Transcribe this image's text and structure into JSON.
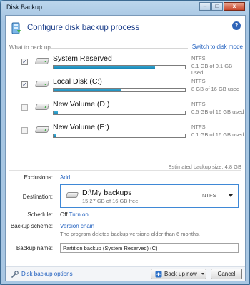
{
  "window": {
    "title": "Disk Backup",
    "controls": {
      "minimize": "–",
      "maximize": "□",
      "close": "x"
    }
  },
  "header": {
    "title": "Configure disk backup process",
    "help_icon": "?"
  },
  "what_to_back_up": {
    "label": "What to back up",
    "switch_link": "Switch to disk mode",
    "disks": [
      {
        "name": "System Reserved",
        "checked": true,
        "fs": "NTFS",
        "used": "0.1 GB of 0.1 GB used",
        "usage_fraction": 0.77
      },
      {
        "name": "Local Disk (C:)",
        "checked": true,
        "fs": "NTFS",
        "used": "8 GB of 16 GB used",
        "usage_fraction": 0.51
      },
      {
        "name": "New Volume (D:)",
        "checked": false,
        "fs": "NTFS",
        "used": "0.5 GB of 16 GB used",
        "usage_fraction": 0.03
      },
      {
        "name": "New Volume (E:)",
        "checked": false,
        "fs": "NTFS",
        "used": "0.1 GB of 16 GB used",
        "usage_fraction": 0.02
      }
    ],
    "checkmark": "✓"
  },
  "estimate": "Estimated backup size:  4.8 GB",
  "exclusions": {
    "label": "Exclusions:",
    "link": "Add"
  },
  "destination": {
    "label": "Destination:",
    "path": "D:\\My backups",
    "free": "15.27 GB of 16 GB free",
    "fs": "NTFS"
  },
  "schedule": {
    "label": "Schedule:",
    "value": "Off",
    "link": "Turn on"
  },
  "scheme": {
    "label": "Backup scheme:",
    "link": "Version chain",
    "description": "The program deletes backup versions older than 6 months."
  },
  "backup_name": {
    "label": "Backup name:",
    "value": "Partition backup (System Reserved) (C)"
  },
  "footer": {
    "options_link": "Disk backup options",
    "backup_button": "Back up now",
    "cancel_button": "Cancel"
  },
  "colors": {
    "accent": "#1f5fbf",
    "progress": "#1683b5",
    "title": "#1d3f8a"
  },
  "icons": {
    "header": "backup-icon",
    "drive": "hard-drive-icon",
    "wrench": "wrench-icon",
    "backup": "backup-now-icon"
  }
}
